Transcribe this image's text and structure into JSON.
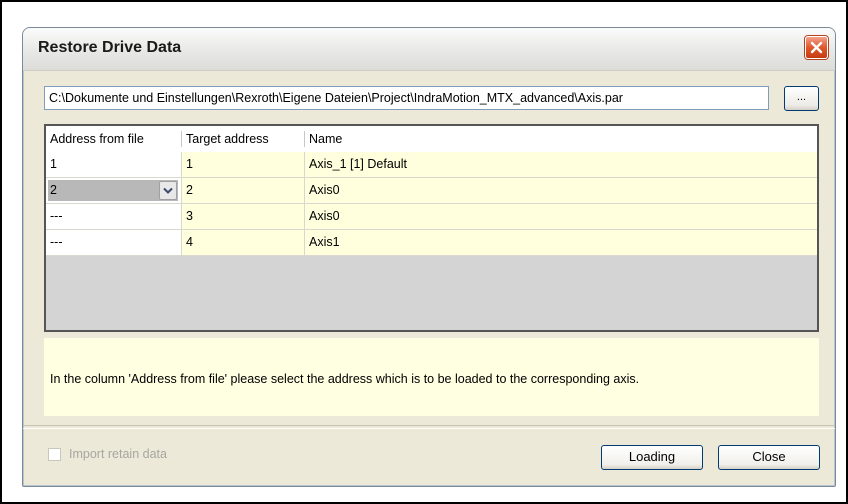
{
  "dialog": {
    "title": "Restore Drive Data",
    "file_path": "C:\\Dokumente und Einstellungen\\Rexroth\\Eigene Dateien\\Project\\IndraMotion_MTX_advanced\\Axis.par",
    "browse_label": "...",
    "columns": [
      "Address from file",
      "Target address",
      "Name"
    ],
    "rows": [
      {
        "address_from_file": "1",
        "target_address": "1",
        "name": "Axis_1 [1] Default"
      },
      {
        "address_from_file": "2",
        "target_address": "2",
        "name": "Axis0"
      },
      {
        "address_from_file": "---",
        "target_address": "3",
        "name": "Axis0"
      },
      {
        "address_from_file": "---",
        "target_address": "4",
        "name": "Axis1"
      }
    ],
    "info_text": "In the column 'Address from file' please select the address which is to be loaded to the corresponding axis.",
    "import_retain_label": "Import retain data",
    "import_retain_checked": false,
    "loading_label": "Loading",
    "close_label": "Close"
  },
  "colors": {
    "editable_cell_bg": "#ffffde",
    "info_bg": "#ffffe1",
    "close_button": "#e0582c"
  }
}
